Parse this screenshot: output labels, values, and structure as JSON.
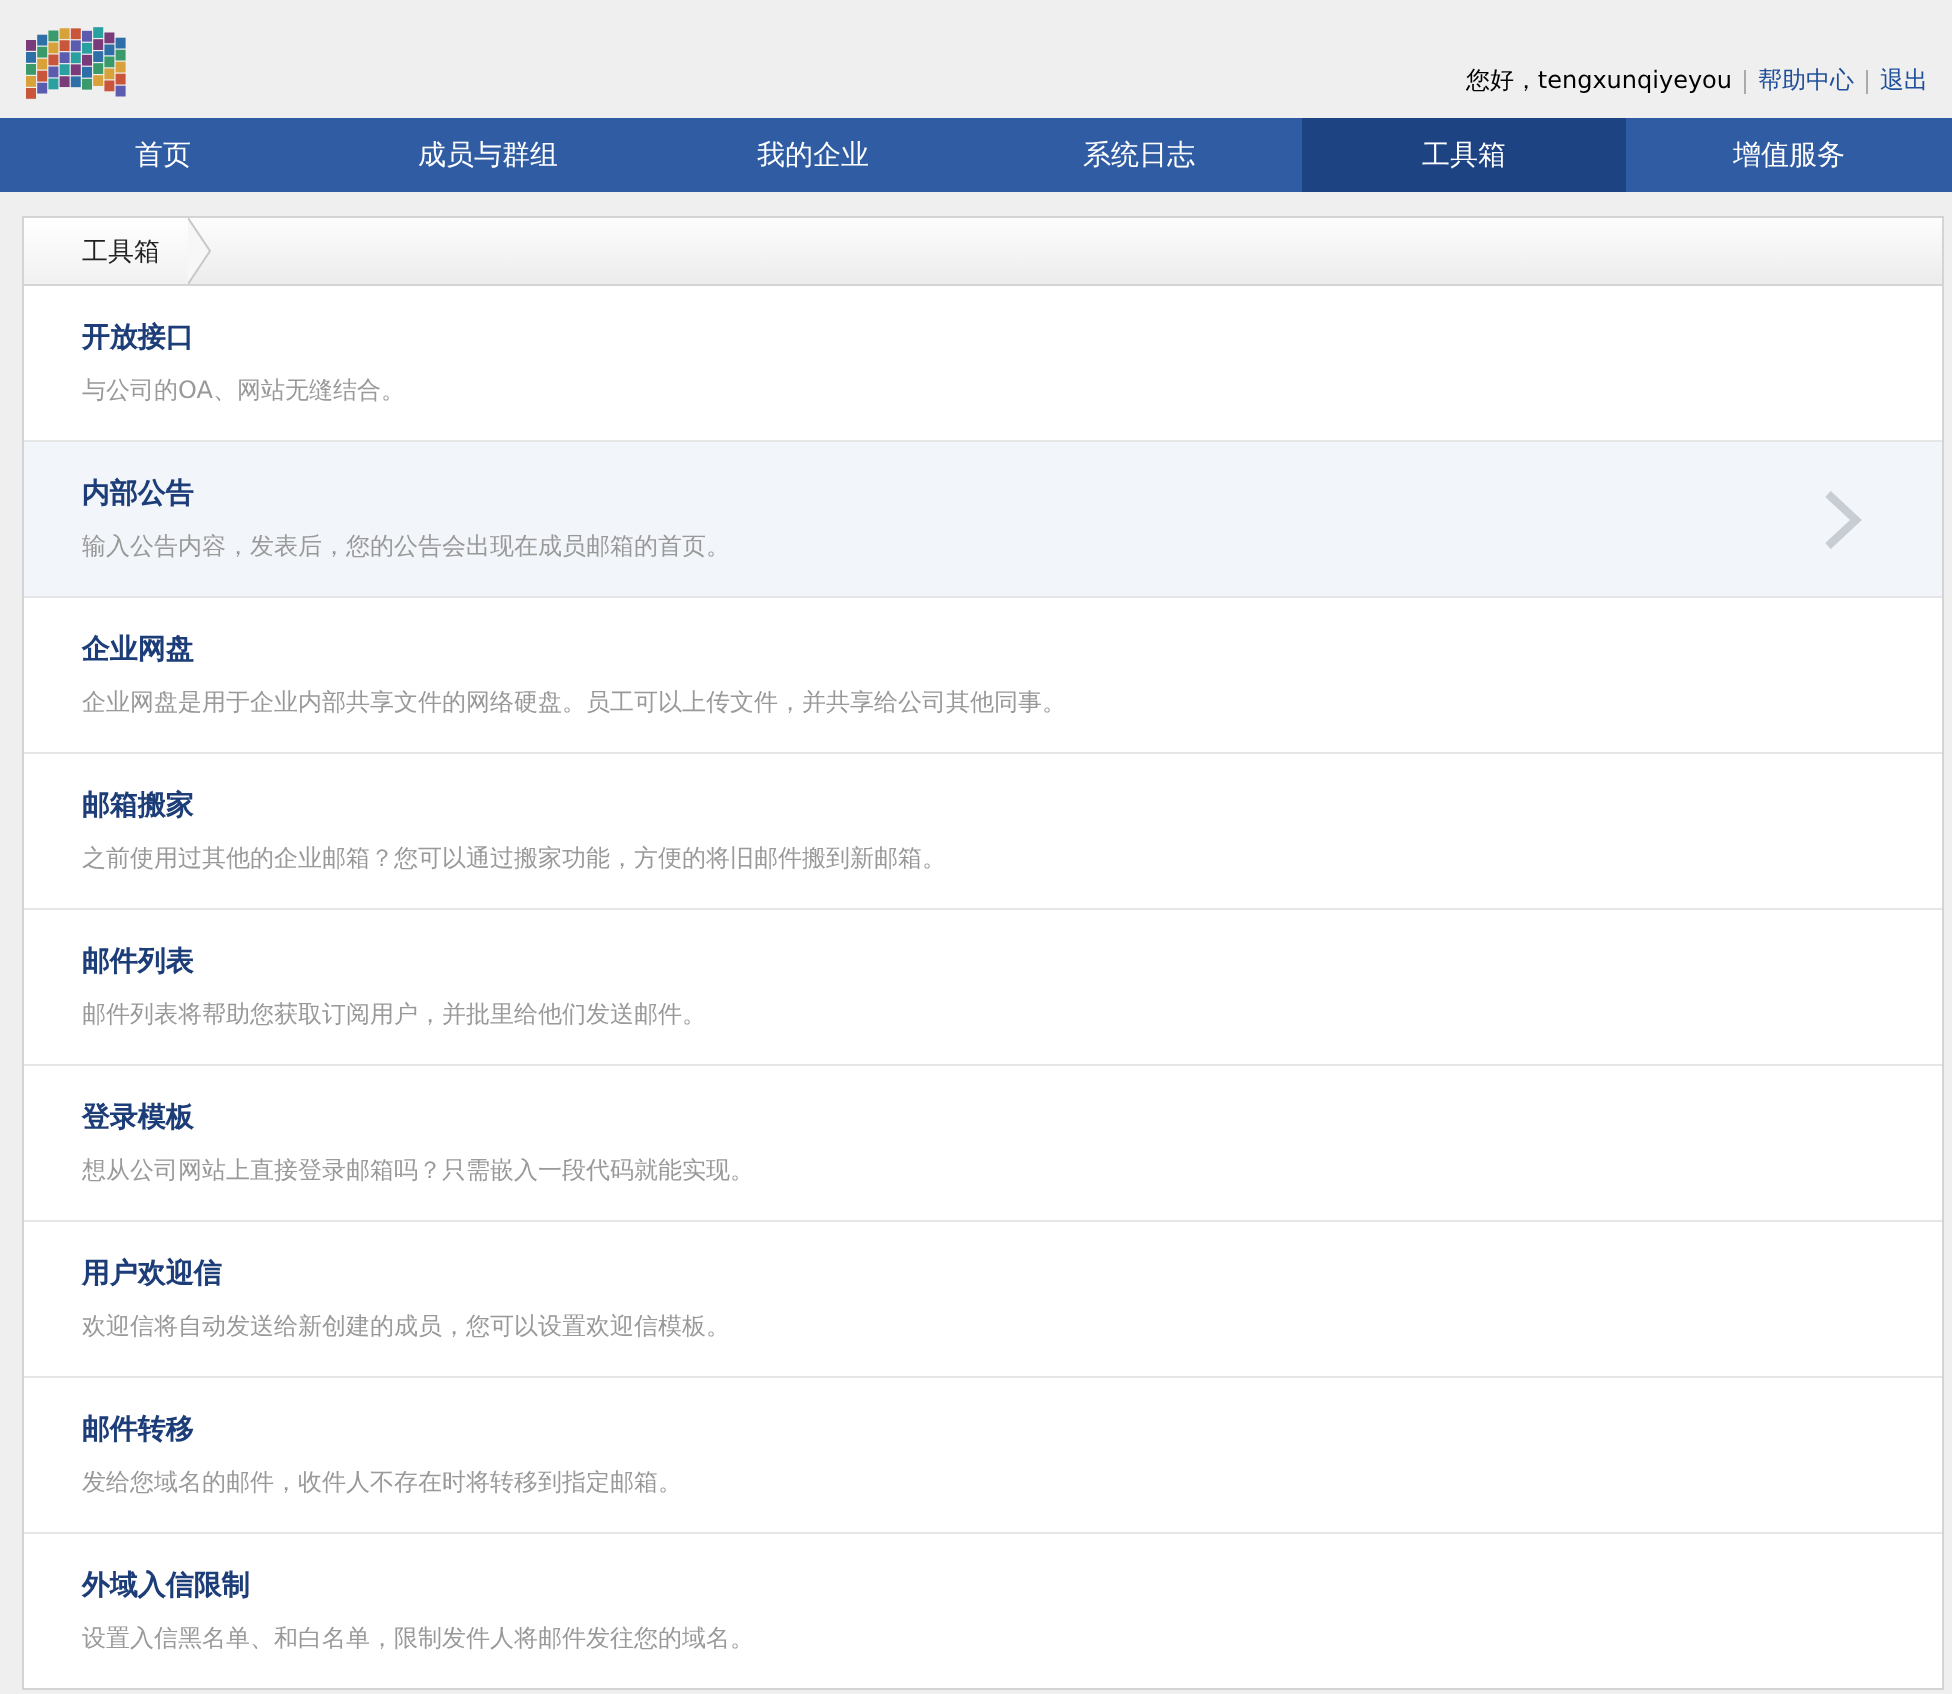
{
  "header": {
    "greeting": "您好，tengxunqiyeyou",
    "links": [
      "帮助中心",
      "退出"
    ]
  },
  "nav": [
    {
      "label": "首页",
      "selected": false
    },
    {
      "label": "成员与群组",
      "selected": false
    },
    {
      "label": "我的企业",
      "selected": false
    },
    {
      "label": "系统日志",
      "selected": false
    },
    {
      "label": "工具箱",
      "selected": true
    },
    {
      "label": "增值服务",
      "selected": false
    }
  ],
  "breadcrumb": "工具箱",
  "tools": [
    {
      "title": "开放接口",
      "description": "与公司的OA、网站无缝结合。",
      "selected": false
    },
    {
      "title": "内部公告",
      "description": "输入公告内容，发表后，您的公告会出现在成员邮箱的首页。",
      "selected": true
    },
    {
      "title": "企业网盘",
      "description": "企业网盘是用于企业内部共享文件的网络硬盘。员工可以上传文件，并共享给公司其他同事。",
      "selected": false
    },
    {
      "title": "邮箱搬家",
      "description": "之前使用过其他的企业邮箱？您可以通过搬家功能，方便的将旧邮件搬到新邮箱。",
      "selected": false
    },
    {
      "title": "邮件列表",
      "description": "邮件列表将帮助您获取订阅用户，并批里给他们发送邮件。",
      "selected": false
    },
    {
      "title": "登录模板",
      "description": "想从公司网站上直接登录邮箱吗？只需嵌入一段代码就能实现。",
      "selected": false
    },
    {
      "title": "用户欢迎信",
      "description": "欢迎信将自动发送给新创建的成员，您可以设置欢迎信模板。",
      "selected": false
    },
    {
      "title": "邮件转移",
      "description": "发给您域名的邮件，收件人不存在时将转移到指定邮箱。",
      "selected": false
    },
    {
      "title": "外域入信限制",
      "description": "设置入信黑名单、和白名单，限制发件人将邮件发往您的域名。",
      "selected": false
    }
  ]
}
